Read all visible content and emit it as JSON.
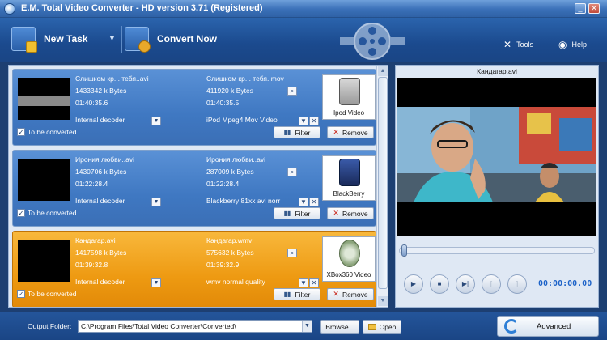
{
  "window": {
    "title": "E.M. Total Video Converter - HD version 3.71 (Registered)",
    "minimize": "_",
    "close": "✕"
  },
  "toolbar": {
    "new_task": "New Task",
    "convert_now": "Convert Now",
    "tools": "Tools",
    "help": "Help"
  },
  "tasks": [
    {
      "src_name": "Слишком кр... тебя..avi",
      "src_size": "1433342 k Bytes",
      "src_duration": "01:40:35.6",
      "decoder": "Internal decoder",
      "dst_name": "Слишком кр... тебя..mov",
      "dst_size": "411920 k Bytes",
      "dst_duration": "01:40:35.5",
      "profile": "iPod Mpeg4 Mov Video",
      "device": "Ipod Video",
      "checkbox_label": "To be converted",
      "filter": "Filter",
      "remove": "Remove",
      "selected": false
    },
    {
      "src_name": "Ирония любви..avi",
      "src_size": "1430706 k Bytes",
      "src_duration": "01:22:28.4",
      "decoder": "Internal decoder",
      "dst_name": "Ирония любви..avi",
      "dst_size": "287009 k Bytes",
      "dst_duration": "01:22:28.4",
      "profile": "Blackberry 81xx avi norr",
      "device": "BlackBerry",
      "checkbox_label": "To be converted",
      "filter": "Filter",
      "remove": "Remove",
      "selected": false
    },
    {
      "src_name": "Кандагар.avi",
      "src_size": "1417598 k Bytes",
      "src_duration": "01:39:32.8",
      "decoder": "Internal decoder",
      "dst_name": "Кандагар.wmv",
      "dst_size": "575632 k Bytes",
      "dst_duration": "01:39:32.9",
      "profile": "wmv normal quality",
      "device": "XBox360 Video",
      "checkbox_label": "To be converted",
      "filter": "Filter",
      "remove": "Remove",
      "selected": true
    }
  ],
  "preview": {
    "filename": "Кандагар.avi",
    "timecode": "00:00:00.00",
    "progress": 0
  },
  "bottom": {
    "output_label": "Output Folder:",
    "output_path": "C:\\Program Files\\Total Video Converter\\Converted\\",
    "browse": "Browse...",
    "open": "Open",
    "advanced": "Advanced"
  },
  "colors": {
    "task_blue": "#4a85cc",
    "task_selected": "#f0a020",
    "timecode": "#1d63c8"
  },
  "icons": {
    "new_task": "add-file-icon",
    "convert": "convert-icon",
    "tools": "tools-icon",
    "help": "help-icon",
    "filter": "filter-icon",
    "remove": "remove-icon",
    "play": "play-icon",
    "stop": "stop-icon",
    "next": "next-icon",
    "advanced": "refresh-icon"
  }
}
